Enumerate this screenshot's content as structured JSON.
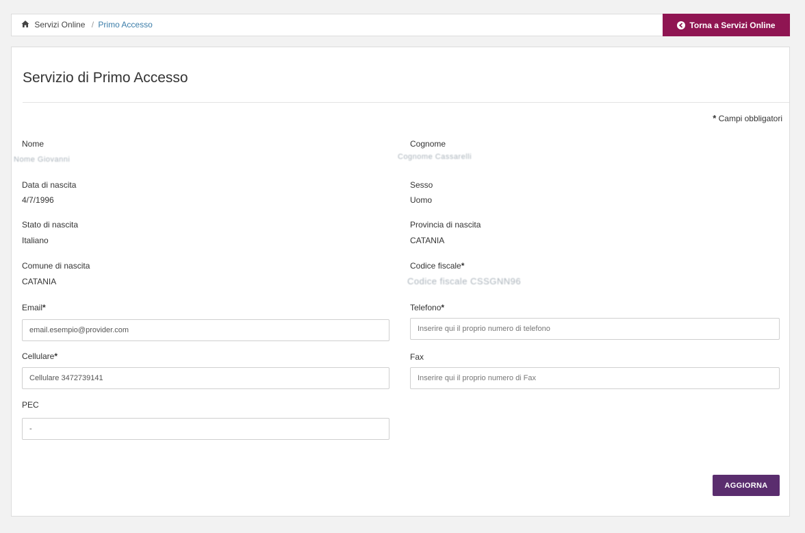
{
  "breadcrumb": {
    "home_label": "Servizi Online",
    "separator": "/",
    "current_label": "Primo Accesso"
  },
  "back_button": {
    "label": "Torna a Servizi Online"
  },
  "page": {
    "title": "Servizio di Primo Accesso",
    "required_note_star": "*",
    "required_note": "Campi obbligatori"
  },
  "fields": {
    "nome": {
      "label": "Nome",
      "value_redacted": "Nome Giovanni"
    },
    "cognome": {
      "label": "Cognome",
      "value_redacted": "Cognome Cassarelli"
    },
    "data_nascita": {
      "label": "Data di nascita",
      "value": "4/7/1996"
    },
    "sesso": {
      "label": "Sesso",
      "value": "Uomo"
    },
    "stato_nascita": {
      "label": "Stato di nascita",
      "value": "Italiano"
    },
    "provincia_nascita": {
      "label": "Provincia di nascita",
      "value": "CATANIA"
    },
    "comune_nascita": {
      "label": "Comune di nascita",
      "value": "CATANIA"
    },
    "codice_fiscale": {
      "label": "Codice fiscale",
      "required": "*",
      "value_redacted": "Codice fiscale CSSGNN96"
    },
    "email": {
      "label": "Email",
      "required": "*",
      "value_redacted": "email.esempio@provider.com"
    },
    "telefono": {
      "label": "Telefono",
      "required": "*",
      "placeholder": "Inserire qui il proprio numero di telefono"
    },
    "cellulare": {
      "label": "Cellulare",
      "required": "*",
      "value_redacted": "Cellulare 3472739141"
    },
    "fax": {
      "label": "Fax",
      "placeholder": "Inserire qui il proprio numero di Fax"
    },
    "pec": {
      "label": "PEC",
      "value": "-"
    }
  },
  "actions": {
    "update_label": "AGGIORNA"
  },
  "colors": {
    "back_button_bg": "#8f1552",
    "update_button_bg": "#5a2d6e",
    "breadcrumb_link": "#3a7ca8",
    "page_bg": "#f2f2f2"
  },
  "icons": {
    "home": "home-icon",
    "back": "arrow-circle-left-icon"
  }
}
